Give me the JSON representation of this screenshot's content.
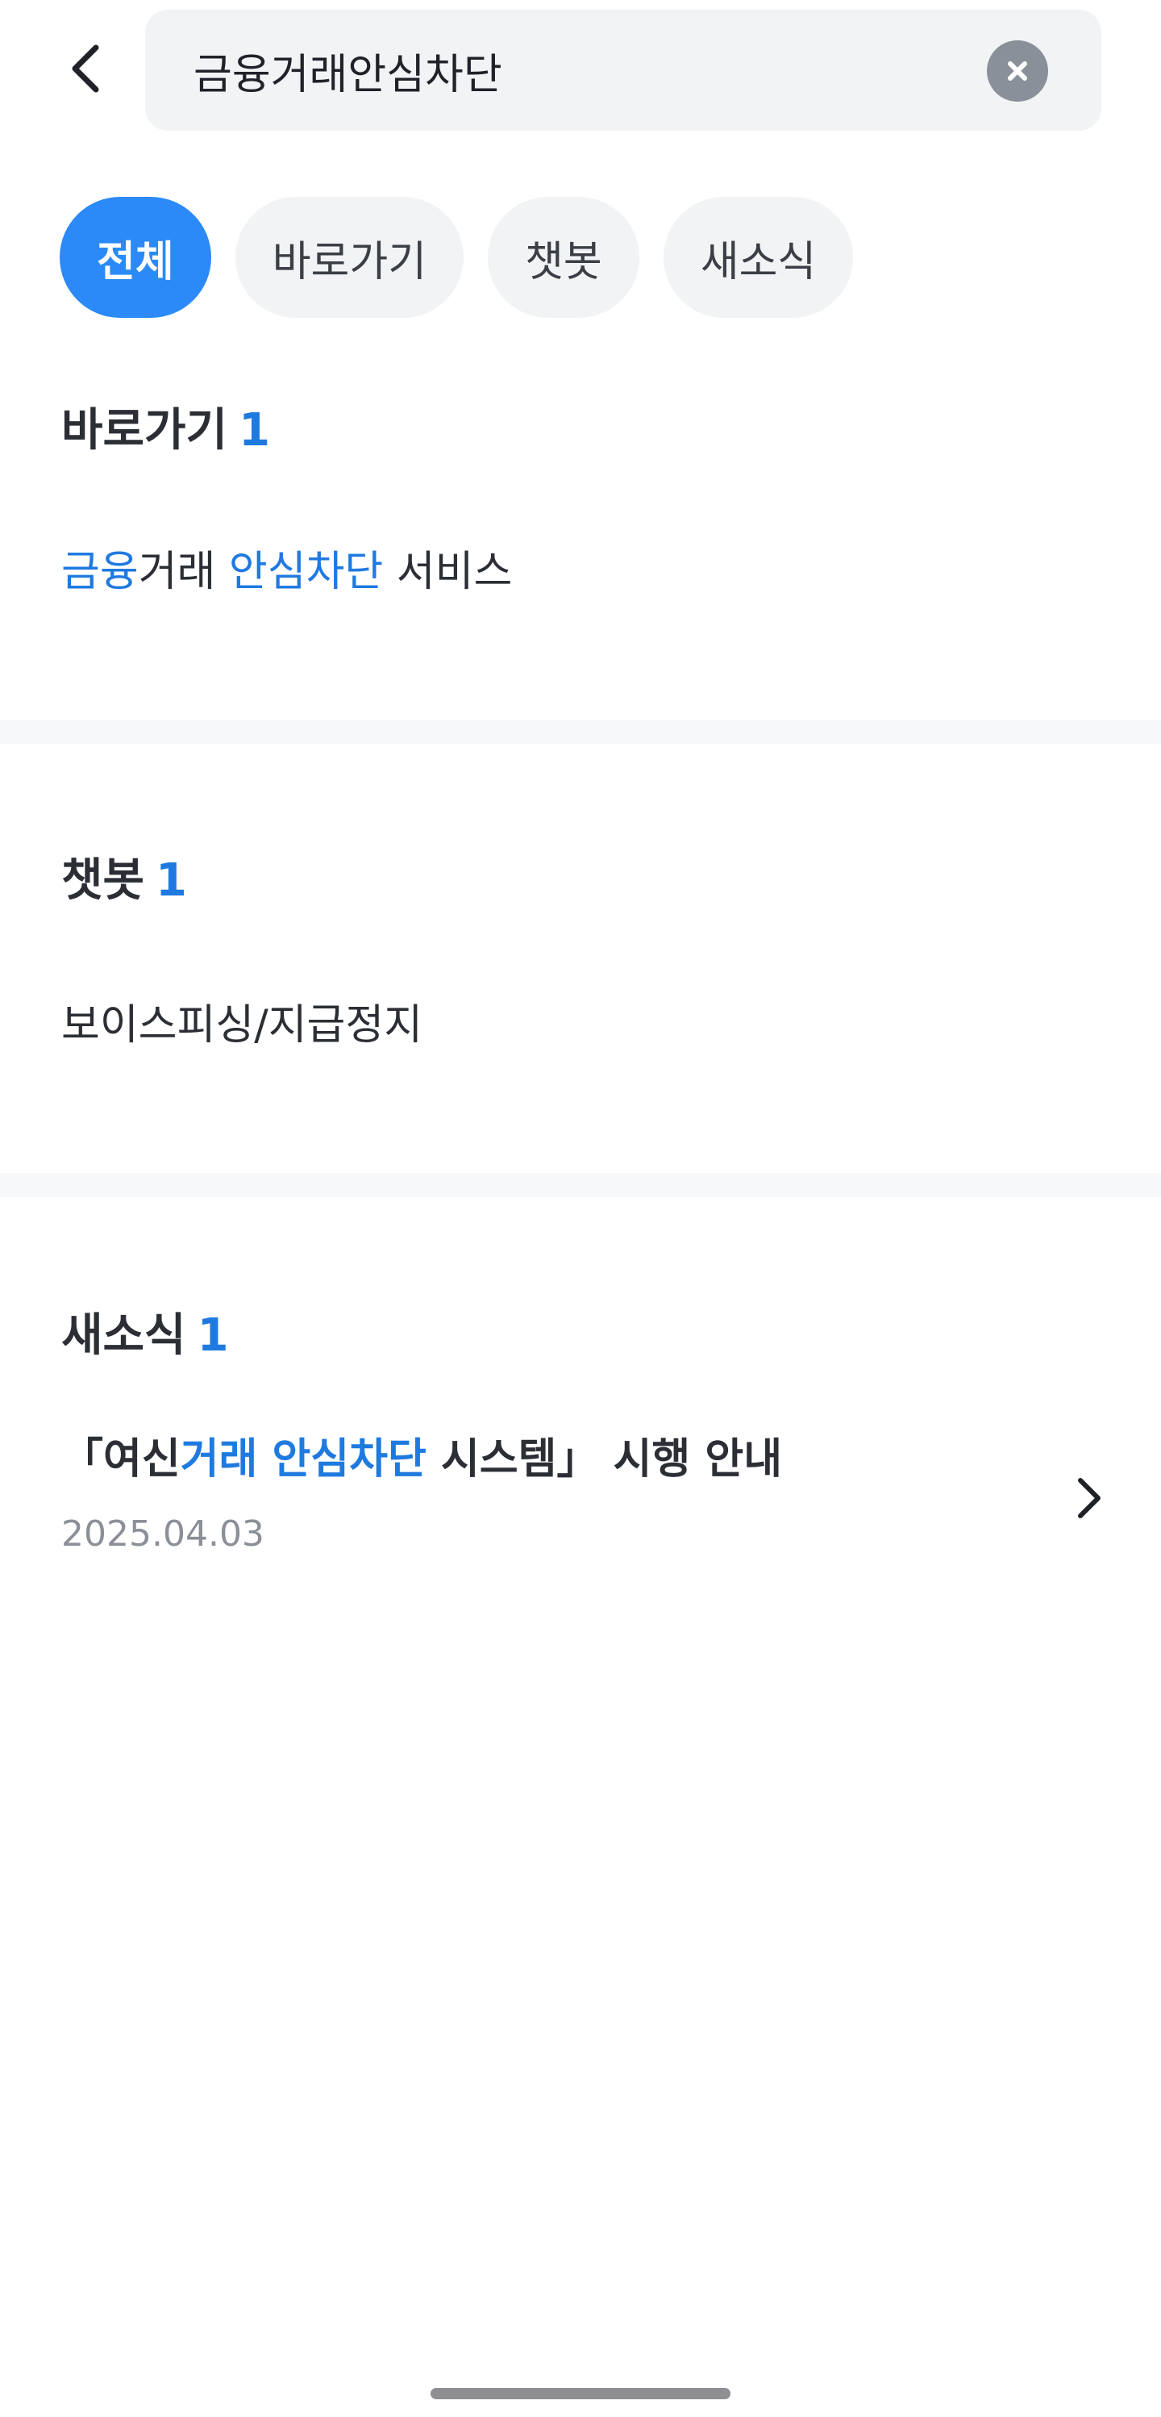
{
  "search": {
    "value": "금융거래안심차단",
    "placeholder": ""
  },
  "icons": {
    "back": "chevron-left-icon",
    "clear": "close-circle-icon",
    "news_arrow": "chevron-right-icon"
  },
  "colors": {
    "accent": "#2b8af7",
    "highlight": "#1f7ae0",
    "chip_bg": "#f2f3f5",
    "divider": "#f7f8f9"
  },
  "filters": [
    {
      "label": "전체",
      "active": true
    },
    {
      "label": "바로가기",
      "active": false
    },
    {
      "label": "챗봇",
      "active": false
    },
    {
      "label": "새소식",
      "active": false
    }
  ],
  "shortcuts": {
    "title": "바로가기",
    "count": "1",
    "result": {
      "part1_hl": "금융",
      "part2": "거래 ",
      "part3_hl": "안심차단",
      "part4": " 서비스"
    }
  },
  "chatbot": {
    "title": "챗봇",
    "count": "1",
    "result": "보이스피싱/지급정지"
  },
  "news": {
    "title": "새소식",
    "count": "1",
    "item": {
      "part1": "「여신",
      "part2_hl": "거래 안심차단",
      "part3": " 시스템」 시행 안내",
      "date": "2025.04.03"
    }
  }
}
